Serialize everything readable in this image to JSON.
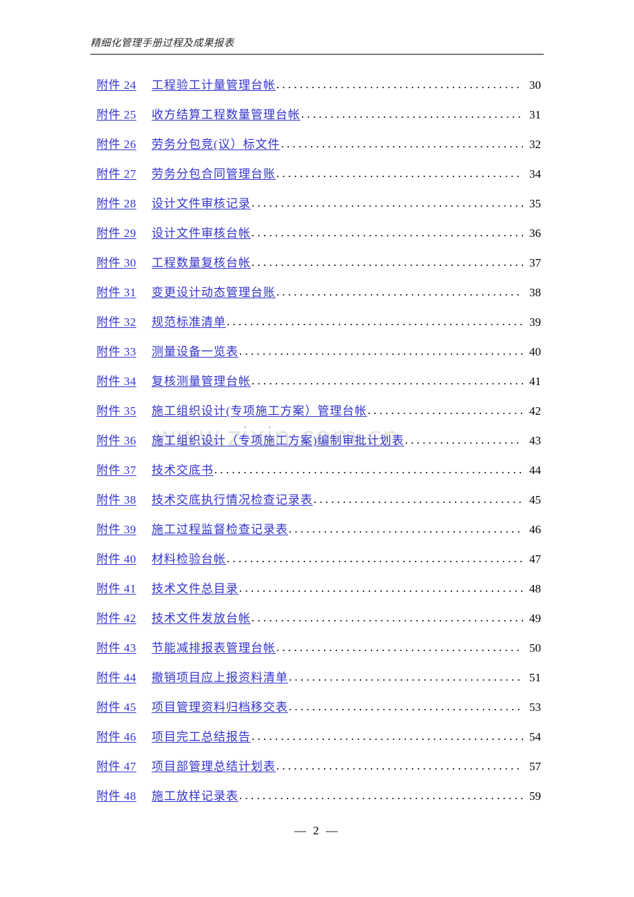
{
  "document": {
    "header_text": "精细化管理手册过程及成果报表",
    "watermark": "www.zixin.com.cn",
    "footer_page_marker": "— 2 —",
    "link_color": "#3333CC",
    "text_color": "#000000",
    "background_color": "#FFFFFF",
    "leader_char": "."
  },
  "toc": {
    "entries": [
      {
        "tag": "附件 24",
        "title": "工程验工计量管理台帐",
        "page": "30"
      },
      {
        "tag": "附件 25",
        "title": "收方结算工程数量管理台帐",
        "page": "31"
      },
      {
        "tag": "附件 26",
        "title": "劳务分包竞(议）标文件",
        "page": "32"
      },
      {
        "tag": "附件 27",
        "title": "劳务分包合同管理台账",
        "page": "34"
      },
      {
        "tag": "附件 28",
        "title": "设计文件审核记录",
        "page": "35"
      },
      {
        "tag": "附件 29",
        "title": "设计文件审核台帐",
        "page": "36"
      },
      {
        "tag": "附件 30",
        "title": "工程数量复核台帐",
        "page": "37"
      },
      {
        "tag": "附件 31",
        "title": "变更设计动态管理台账",
        "page": "38"
      },
      {
        "tag": "附件 32",
        "title": "规范标准清单",
        "page": "39"
      },
      {
        "tag": "附件 33",
        "title": "测量设备一览表",
        "page": "40"
      },
      {
        "tag": "附件 34",
        "title": "复核测量管理台帐",
        "page": "41"
      },
      {
        "tag": "附件 35",
        "title": "施工组织设计(专项施工方案）管理台帐",
        "page": "42"
      },
      {
        "tag": "附件 36",
        "title": "施工组织设计（专项施工方案)编制审批计划表",
        "page": "43"
      },
      {
        "tag": "附件 37",
        "title": "技术交底书",
        "page": "44"
      },
      {
        "tag": "附件 38",
        "title": "技术交底执行情况检查记录表",
        "page": "45"
      },
      {
        "tag": "附件 39",
        "title": "施工过程监督检查记录表",
        "page": "46"
      },
      {
        "tag": "附件 40",
        "title": "材料检验台帐",
        "page": "47"
      },
      {
        "tag": "附件 41",
        "title": "技术文件总目录",
        "page": "48"
      },
      {
        "tag": "附件 42",
        "title": "技术文件发放台帐",
        "page": "49"
      },
      {
        "tag": "附件 43",
        "title": "节能减排报表管理台帐",
        "page": "50"
      },
      {
        "tag": "附件 44",
        "title": "撤销项目应上报资料清单",
        "page": "51"
      },
      {
        "tag": "附件 45",
        "title": "项目管理资料归档移交表",
        "page": "53"
      },
      {
        "tag": "附件 46",
        "title": "项目完工总结报告",
        "page": "54"
      },
      {
        "tag": "附件 47",
        "title": "项目部管理总结计划表",
        "page": "57"
      },
      {
        "tag": "附件 48",
        "title": "施工放样记录表",
        "page": "59"
      }
    ]
  }
}
